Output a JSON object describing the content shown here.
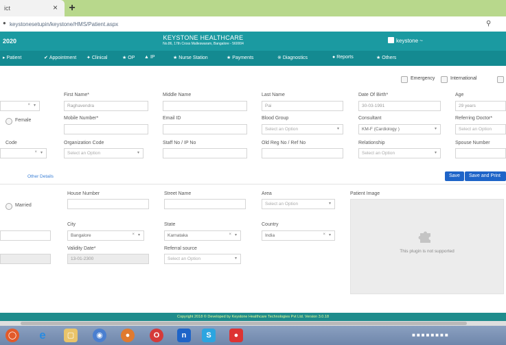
{
  "browser": {
    "tab_title": "ict",
    "tab_close": "×",
    "new_tab": "+",
    "url": "keystonesetupin/keystone/HMS/Patient.aspx",
    "zoom_icon": "magnifier-icon"
  },
  "header": {
    "year": "2020",
    "brand_name": "KEYSTONE HEALTHCARE",
    "brand_sub": "No.86, 17th Cross Malleswaram, Bangalore - 560004",
    "user": "keystone ~"
  },
  "nav": {
    "items": [
      "Patient",
      "Appointment",
      "Clinical",
      "OP",
      "IP",
      "Nurse Station",
      "Payments",
      "Diagnostics",
      "Reports",
      "Others"
    ]
  },
  "options": {
    "emergency": "Emergency",
    "international": "International"
  },
  "form": {
    "first_name_label": "First Name*",
    "first_name_value": "Raghavendra",
    "middle_name_label": "Middle Name",
    "last_name_label": "Last Name",
    "last_name_value": "Pai",
    "dob_label": "Date Of Birth*",
    "dob_value": "30-03-1991",
    "age_label": "Age",
    "age_value": "29 years",
    "gender_female": "Female",
    "mobile_label": "Mobile Number*",
    "email_label": "Email ID",
    "blood_group_label": "Blood Group",
    "blood_group_placeholder": "Select an Option",
    "consultant_label": "Consultant",
    "consultant_value": "KM-F (Cardiology )",
    "referring_label": "Referring Doctor*",
    "referring_placeholder": "Select an Option",
    "code_label": "Code",
    "org_code_label": "Organization Code",
    "org_code_placeholder": "Select an Option",
    "staff_label": "Staff No / IP No",
    "old_reg_label": "Old Reg No / Ref No",
    "relationship_label": "Relationship",
    "relationship_placeholder": "Select an Option",
    "spouse_label": "Spouse Number"
  },
  "tabs": {
    "other_details": "Other Details"
  },
  "buttons": {
    "save": "Save",
    "save_print": "Save and Print"
  },
  "details": {
    "married": "Married",
    "house_label": "House Number",
    "street_label": "Street Name",
    "area_label": "Area",
    "area_placeholder": "Select an Option",
    "patient_image_label": "Patient Image",
    "city_label": "City",
    "city_value": "Bangalore",
    "state_label": "State",
    "state_value": "Karnataka",
    "country_label": "Country",
    "country_value": "India",
    "validity_label": "Validity Date*",
    "validity_value": "13-01-2300",
    "referral_label": "Referral source",
    "referral_placeholder": "Select an Option",
    "plugin_msg": "This plugin is not supported"
  },
  "footer": "Copyright 2018 © Developed by Keystone Healthcare Technologies Pvt Ltd. Version 3.0.18",
  "taskbar": {
    "icons": [
      "windows-icon",
      "ie-icon",
      "explorer-icon",
      "chrome-icon",
      "firefox-icon",
      "opera-icon",
      "onenote-icon",
      "skype-icon",
      "video-icon"
    ]
  }
}
